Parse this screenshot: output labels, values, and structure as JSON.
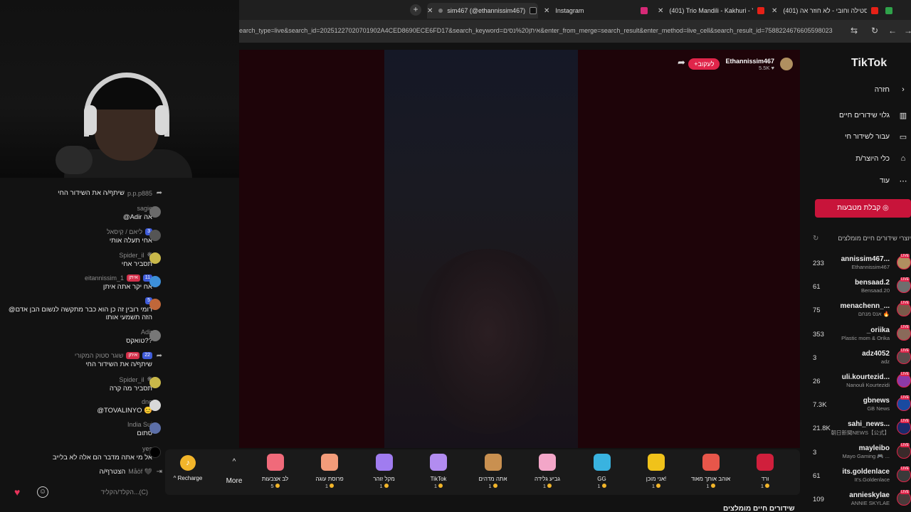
{
  "browser": {
    "tabs": [
      {
        "title": "sim467 (@ethannissim467)",
        "active": true
      },
      {
        "title": "Instagram"
      },
      {
        "title": "(401) Trio Mandili - Kakhuri - Yo"
      },
      {
        "title": "(401) סטילה וחובי - לא חוזר אה"
      }
    ],
    "url": "earch_type=live&search_id=20251227020701902A4CED8690ECE6FD17&search_keyword=איתן%20נסים&enter_from_merge=search_result&enter_method=live_cell&search_result_id=7588224676605598023"
  },
  "stream": {
    "streamer_name": "Ethannissim467",
    "viewer_count": "5.5K",
    "follow_label": "+לעקוב"
  },
  "chat": {
    "messages": [
      {
        "user": "p.p.p885",
        "text": "שיתף/ה את השידור החי",
        "share": true
      },
      {
        "user": "sagie",
        "text": "@Adir אה",
        "avatar_color": "#6a6a6a"
      },
      {
        "user": "ליאם / קַיִסאל",
        "badge_lvl": "3",
        "text": "אחי תעלה אותי",
        "avatar_color": "#555"
      },
      {
        "user": "Spider_il",
        "text": "תסביר אחי",
        "avatar_color": "#c9b84a"
      },
      {
        "user": "eitannissim_1",
        "badge_lvl": "11",
        "badge_fan": "איתן",
        "text": "אח יקר אתה איתן",
        "avatar_color": "#3d8fd8"
      },
      {
        "user": "",
        "badge_lvl": "5",
        "text": "@רומי רובין זה כן הוא כבר מתקשה לנשום הבן אדם הזה תשמעי אותו",
        "avatar_color": "#c0673a"
      },
      {
        "user": "Adir",
        "text": "טואקס??",
        "avatar_color": "#777"
      },
      {
        "user": "שוגר סטוק המקורי",
        "badge_lvl": "22",
        "badge_fan": "איתן",
        "text": "שיתף/ה את השידור החי",
        "share": true
      },
      {
        "user": "Spider_il",
        "text": "תסביר מה קרה",
        "avatar_color": "#c9b84a"
      },
      {
        "user": "dne",
        "text": "@TOVALINYO 😊",
        "avatar_color": "#d8d8d8"
      },
      {
        "user": "India Sui",
        "text": "סתום",
        "avatar_color": "#5c6fa8"
      },
      {
        "user": "yes",
        "text": "אל מי אתה מדבר הם אלה לא בלייב",
        "avatar_color": "#000"
      },
      {
        "user": "Måöf 🖤",
        "text": "הצטרף/ה",
        "join": true
      }
    ],
    "input_placeholder": "הקלד/הקליד...(C)"
  },
  "gifts": {
    "recharge_label": "Recharge",
    "more_label": "More",
    "items": [
      {
        "name": "ורד",
        "price": "1",
        "color": "#d01f3c"
      },
      {
        "name": "אוהב אותך מאוד",
        "price": "1",
        "color": "#e7564a"
      },
      {
        "name": "אני מוכן!",
        "price": "1",
        "color": "#f0c21a"
      },
      {
        "name": "GG",
        "price": "1",
        "color": "#39b3e0"
      },
      {
        "name": "גביע גלידה",
        "price": "1",
        "color": "#f3a6c8"
      },
      {
        "name": "אתה מדהים",
        "price": "1",
        "color": "#c99050"
      },
      {
        "name": "TikTok",
        "price": "1",
        "color": "#b28cf0"
      },
      {
        "name": "מקל זוהר",
        "price": "1",
        "color": "#a07cf0"
      },
      {
        "name": "פרוסת עוגה",
        "price": "1",
        "color": "#f39c7a"
      },
      {
        "name": "לב אצבעות",
        "price": "5",
        "color": "#f06a7a"
      }
    ]
  },
  "bottom_section_title": "שידורים חיים מומלצים",
  "sidebar": {
    "logo": "TikTok",
    "nav": [
      {
        "label": "חזרה",
        "icon": "back-arrow-icon"
      },
      {
        "label": "גלוי שידורים חיים",
        "icon": "live-chart-icon"
      },
      {
        "label": "עבור לשידור חי",
        "icon": "camera-icon"
      },
      {
        "label": "כלי היוצר/ת",
        "icon": "creator-tools-icon"
      },
      {
        "label": "עוד",
        "icon": "more-dots-icon"
      }
    ],
    "coins_button": "קבלת מטבעות",
    "section_header": "יוצרי שידורים חיים מומלצים",
    "recommended": [
      {
        "name": "annissim467...",
        "sub": "Ethannissim467",
        "count": "233",
        "color": "#b08f60"
      },
      {
        "name": "bensaad.2",
        "sub": "Bensaad.20",
        "count": "61",
        "color": "#6e6e6e"
      },
      {
        "name": "menachenn_...",
        "sub": "אנס מנחם 🔥",
        "count": "75",
        "color": "#7a5a4a"
      },
      {
        "name": "_oriika",
        "sub": "Plastic mom & Orika",
        "count": "353",
        "color": "#8a6a5a"
      },
      {
        "name": "adz4052",
        "sub": "adz",
        "count": "3",
        "color": "#5a4a4a"
      },
      {
        "name": "uli.kourtezid...",
        "sub": "Nanouli Kourtezidi",
        "count": "26",
        "color": "#8c3aa8"
      },
      {
        "name": "gbnews",
        "sub": "GB News",
        "count": "7.3K",
        "color": "#1a4aa0"
      },
      {
        "name": "sahi_news...",
        "sub": "朝日新聞NEWS【公式】",
        "count": "21.8K",
        "color": "#1a2a6a"
      },
      {
        "name": "mayleibo",
        "sub": "Mayo Gaming 🎮 ...",
        "count": "3",
        "color": "#3a2a2a"
      },
      {
        "name": "its.goldenlace",
        "sub": "It's.Goldenlace",
        "count": "61",
        "color": "#3a3a3a"
      },
      {
        "name": "annieskylae",
        "sub": "ANNIE SKYLAE",
        "count": "109",
        "color": "#4a3a3a"
      }
    ]
  }
}
